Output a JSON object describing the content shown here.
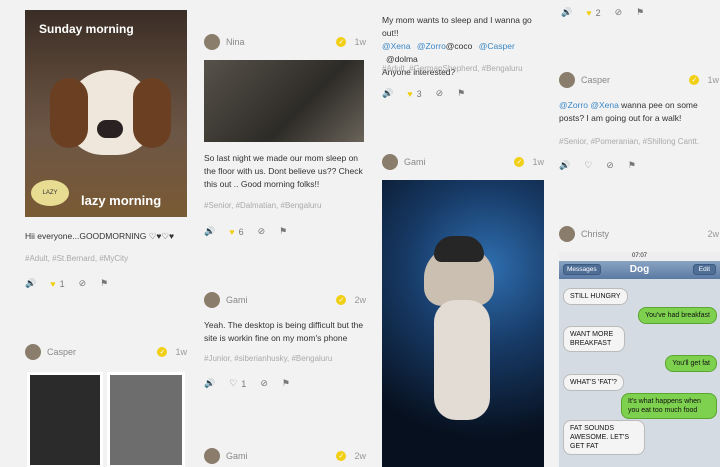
{
  "col1": {
    "post1": {
      "image_title": "Sunday morning",
      "image_caption": "lazy morning",
      "text": "Hii everyone...GOODMORNING ♡♥♡♥",
      "tags": "#Adult, #St.Bernard, #MyCity",
      "likes": "1"
    },
    "post2": {
      "author": "Casper",
      "time": "1w"
    }
  },
  "col2": {
    "post1": {
      "author": "Nina",
      "time": "1w",
      "text": "So last night we made our mom sleep on the floor with us. Dont believe us?? Check this out .. Good morning folks!!",
      "tags": "#Senior, #Dalmatian, #Bengaluru",
      "likes": "6"
    },
    "post2": {
      "author": "Gami",
      "time": "2w",
      "text": "Yeah. The desktop is being difficult but the site is workin fine on my mom's phone",
      "tags": "#Junior, #siberianhusky, #Bengaluru",
      "likes": "1"
    },
    "post3": {
      "author": "Gami",
      "time": "2w"
    }
  },
  "col3": {
    "post1": {
      "text_line1": "My mom wants to sleep and I wanna go out!!",
      "mention1": "@Xena",
      "mention2": "@Zorro",
      "plain1": "@coco",
      "mention3": "@Casper",
      "plain2": "@dolma",
      "text_line3": "Anyone interested?",
      "tags": "#Adult, #GermanShepherd, #Bengaluru",
      "likes": "3"
    },
    "post2": {
      "author": "Gami",
      "time": "1w"
    }
  },
  "col4": {
    "post0": {
      "likes": "2"
    },
    "post1": {
      "author": "Casper",
      "time": "1w",
      "mention1": "@Zorro",
      "mention2": "@Xena",
      "text": "wanna pee on some posts? I am going out for a walk!",
      "tags": "#Senior, #Pomeranian, #Shillong Cantt."
    },
    "post2": {
      "author": "Christy",
      "time": "2w",
      "phone": {
        "clock": "07:07",
        "back_label": "Messages",
        "title": "Dog",
        "edit_label": "Edit",
        "messages": [
          {
            "side": "left",
            "text": "STILL HUNGRY"
          },
          {
            "side": "right",
            "text": "You've had breakfast"
          },
          {
            "side": "left",
            "text": "WANT MORE BREAKFAST"
          },
          {
            "side": "right",
            "text": "You'll get fat"
          },
          {
            "side": "left",
            "text": "WHAT'S 'FAT'?"
          },
          {
            "side": "right",
            "text": "It's what happens when you eat too much food"
          },
          {
            "side": "left",
            "text": "FAT SOUNDS AWESOME. LET'S GET FAT"
          }
        ]
      }
    }
  },
  "colors": {
    "accent_yellow": "#f1cf15",
    "mention_blue": "#3a87c7",
    "bubble_green": "#7ed04f"
  }
}
